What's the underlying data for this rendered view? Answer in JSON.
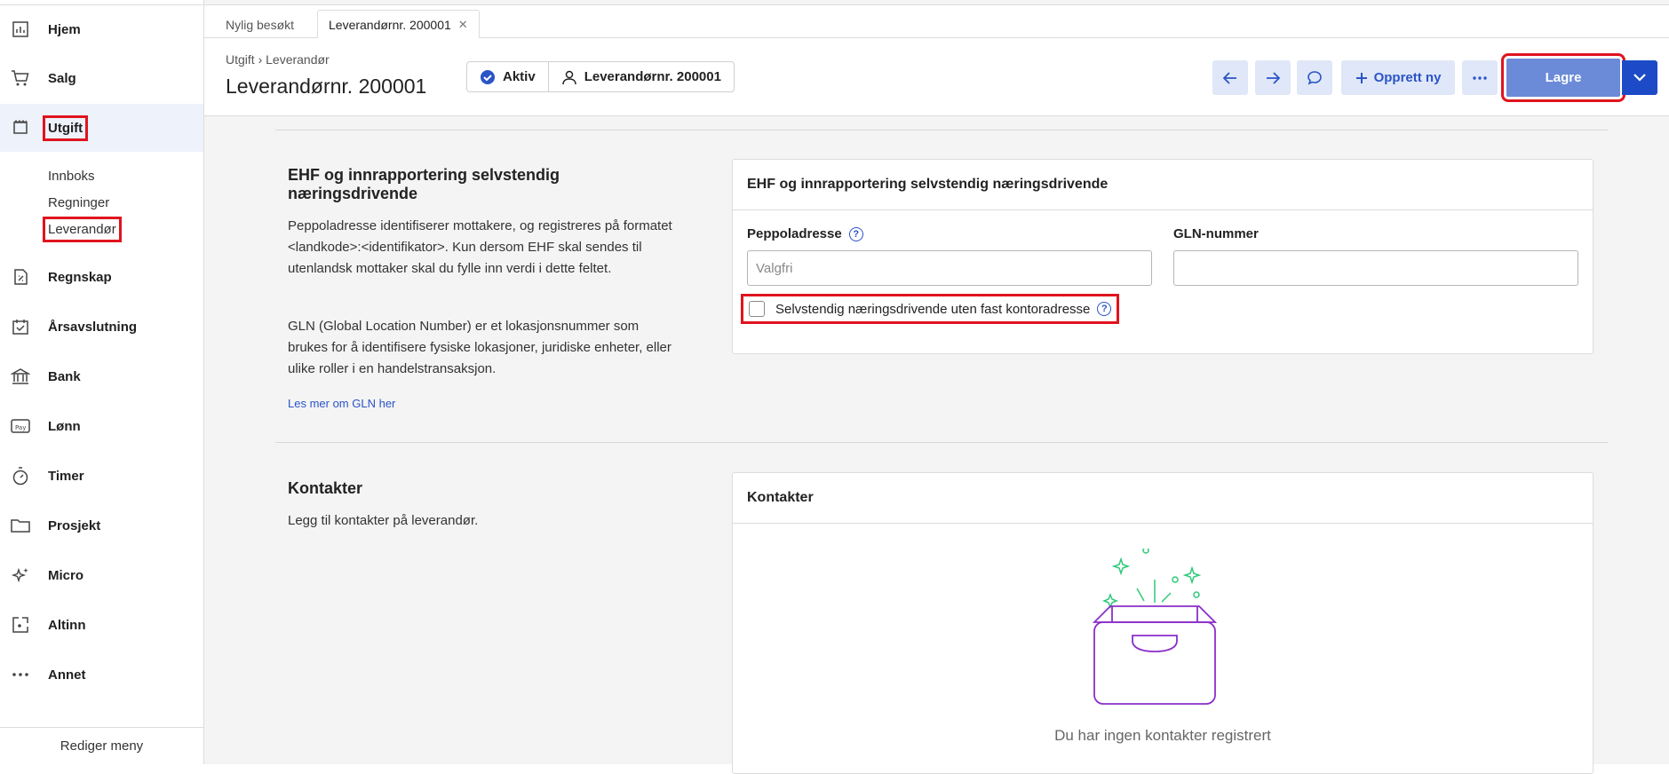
{
  "sidebar": {
    "items": [
      {
        "label": "Hjem",
        "icon": "chart-icon"
      },
      {
        "label": "Salg",
        "icon": "cart-icon"
      },
      {
        "label": "Utgift",
        "icon": "receipt-icon"
      },
      {
        "label": "Regnskap",
        "icon": "ledger-icon"
      },
      {
        "label": "Årsavslutning",
        "icon": "calendar-check-icon"
      },
      {
        "label": "Bank",
        "icon": "bank-icon"
      },
      {
        "label": "Lønn",
        "icon": "pay-icon"
      },
      {
        "label": "Timer",
        "icon": "stopwatch-icon"
      },
      {
        "label": "Prosjekt",
        "icon": "folder-icon"
      },
      {
        "label": "Micro",
        "icon": "sparkle-icon"
      },
      {
        "label": "Altinn",
        "icon": "altinn-icon"
      },
      {
        "label": "Annet",
        "icon": "more-icon"
      }
    ],
    "subitems": [
      "Innboks",
      "Regninger",
      "Leverandør"
    ],
    "edit_menu": "Rediger meny"
  },
  "tabs": {
    "recent": "Nylig besøkt",
    "current": "Leverandørnr. 200001"
  },
  "header": {
    "breadcrumb": "Utgift › Leverandør",
    "title": "Leverandørnr. 200001",
    "status": "Aktiv",
    "supplier": "Leverandørnr. 200001",
    "create_new": "Opprett ny",
    "save": "Lagre"
  },
  "ehf": {
    "title": "EHF og innrapportering selvstendig næringsdrivende",
    "text1": "Peppoladresse identifiserer mottakere, og registreres på formatet <landkode>:<identifikator>. Kun dersom EHF skal sendes til utenlandsk mottaker skal du fylle inn verdi i dette feltet.",
    "text2": "GLN (Global Location Number) er et lokasjonsnummer som brukes for å identifisere fysiske lokasjoner, juridiske enheter, eller ulike roller i en handelstransaksjon.",
    "link": "Les mer om GLN her",
    "card_title": "EHF og innrapportering selvstendig næringsdrivende",
    "peppol_label": "Peppoladresse",
    "peppol_placeholder": "Valgfri",
    "peppol_value": "",
    "gln_label": "GLN-nummer",
    "gln_value": "",
    "checkbox_label": "Selvstendig næringsdrivende uten fast kontoradresse",
    "checkbox_checked": false
  },
  "contacts": {
    "title": "Kontakter",
    "text": "Legg til kontakter på leverandør.",
    "card_title": "Kontakter",
    "empty": "Du har ingen kontakter registrert"
  },
  "colors": {
    "accent": "#2b54c7",
    "highlight": "#e0141e",
    "save": "#6b8bd8",
    "illustration": "#8a2fc9",
    "sparkle": "#2fc97a"
  }
}
